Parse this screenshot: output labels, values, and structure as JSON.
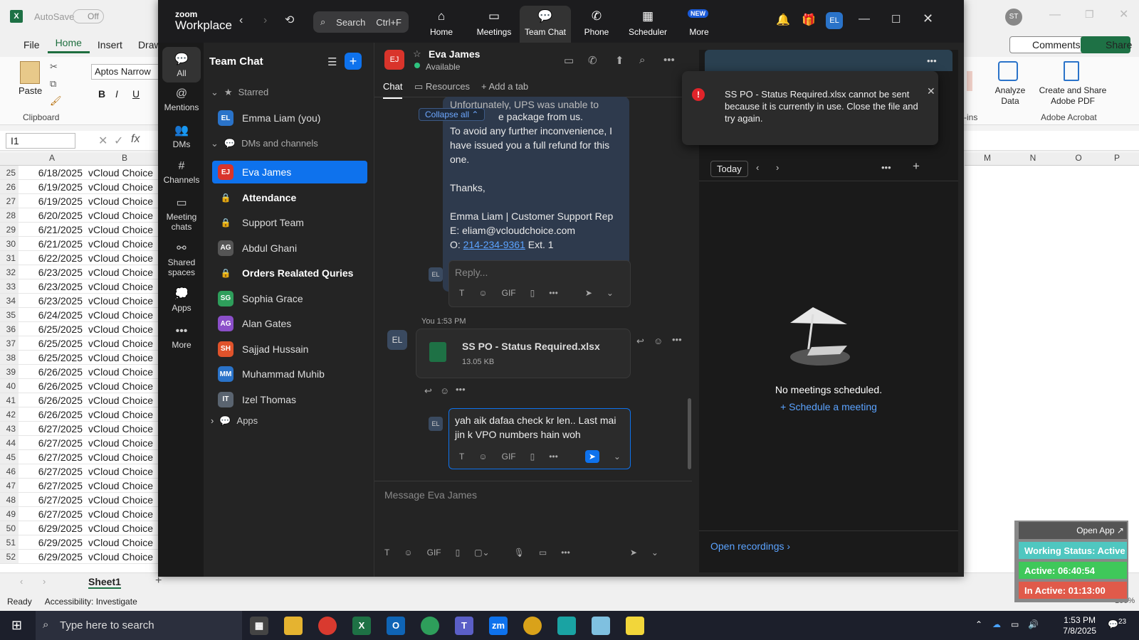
{
  "excel": {
    "autosave_label": "AutoSave",
    "autosave_state": "Off",
    "menu": [
      "File",
      "Home",
      "Insert",
      "Draw"
    ],
    "font_name": "Aptos Narrow",
    "paste_label": "Paste",
    "clipboard_label": "Clipboard",
    "name_box": "I1",
    "col_a": "A",
    "col_b": "B",
    "right_cols": [
      "M",
      "N",
      "O",
      "P"
    ],
    "user_initials": "ST",
    "comments_label": "Comments",
    "share_label": "Share",
    "analyze_label": "Analyze Data",
    "adobe_label": "Create and Share Adobe PDF",
    "adobe_group": "Adobe Acrobat",
    "addins_label": "-ins",
    "rows": [
      {
        "n": "25",
        "a": "6/18/2025",
        "b": "vCloud Choice"
      },
      {
        "n": "26",
        "a": "6/19/2025",
        "b": "vCloud Choice"
      },
      {
        "n": "27",
        "a": "6/19/2025",
        "b": "vCloud Choice"
      },
      {
        "n": "28",
        "a": "6/20/2025",
        "b": "vCloud Choice"
      },
      {
        "n": "29",
        "a": "6/21/2025",
        "b": "vCloud Choice"
      },
      {
        "n": "30",
        "a": "6/21/2025",
        "b": "vCloud Choice"
      },
      {
        "n": "31",
        "a": "6/22/2025",
        "b": "vCloud Choice"
      },
      {
        "n": "32",
        "a": "6/23/2025",
        "b": "vCloud Choice"
      },
      {
        "n": "33",
        "a": "6/23/2025",
        "b": "vCloud Choice"
      },
      {
        "n": "34",
        "a": "6/23/2025",
        "b": "vCloud Choice"
      },
      {
        "n": "35",
        "a": "6/24/2025",
        "b": "vCloud Choice"
      },
      {
        "n": "36",
        "a": "6/25/2025",
        "b": "vCloud Choice"
      },
      {
        "n": "37",
        "a": "6/25/2025",
        "b": "vCloud Choice"
      },
      {
        "n": "38",
        "a": "6/25/2025",
        "b": "vCloud Choice"
      },
      {
        "n": "39",
        "a": "6/26/2025",
        "b": "vCloud Choice"
      },
      {
        "n": "40",
        "a": "6/26/2025",
        "b": "vCloud Choice"
      },
      {
        "n": "41",
        "a": "6/26/2025",
        "b": "vCloud Choice"
      },
      {
        "n": "42",
        "a": "6/26/2025",
        "b": "vCloud Choice"
      },
      {
        "n": "43",
        "a": "6/27/2025",
        "b": "vCloud Choice"
      },
      {
        "n": "44",
        "a": "6/27/2025",
        "b": "vCloud Choice"
      },
      {
        "n": "45",
        "a": "6/27/2025",
        "b": "vCloud Choice"
      },
      {
        "n": "46",
        "a": "6/27/2025",
        "b": "vCloud Choice"
      },
      {
        "n": "47",
        "a": "6/27/2025",
        "b": "vCloud Choice"
      },
      {
        "n": "48",
        "a": "6/27/2025",
        "b": "vCloud Choice"
      },
      {
        "n": "49",
        "a": "6/27/2025",
        "b": "vCloud Choice"
      },
      {
        "n": "50",
        "a": "6/29/2025",
        "b": "vCloud Choice"
      },
      {
        "n": "51",
        "a": "6/29/2025",
        "b": "vCloud Choice"
      },
      {
        "n": "52",
        "a": "6/29/2025",
        "b": "vCloud Choice"
      }
    ],
    "sheet_tab": "Sheet1",
    "status_ready": "Ready",
    "status_access": "Accessibility: Investigate",
    "zoom_pct": "100%"
  },
  "zoom": {
    "brand_top": "zoom",
    "brand_bottom": "Workplace",
    "search_label": "Search",
    "search_shortcut": "Ctrl+F",
    "tabs": [
      "Home",
      "Meetings",
      "Team Chat",
      "Phone",
      "Scheduler",
      "More"
    ],
    "new_badge": "NEW",
    "user_initials": "EL",
    "left_nav": [
      "All",
      "Mentions",
      "DMs",
      "Channels",
      "Meeting chats",
      "Shared spaces",
      "Apps",
      "More"
    ],
    "list_title": "Team Chat",
    "starred_label": "Starred",
    "starred_item": "Emma Liam (you)",
    "dms_label": "DMs and channels",
    "contacts": [
      {
        "name": "Eva James",
        "initials": "EJ",
        "color": "#d9342b",
        "type": "avatar"
      },
      {
        "name": "Attendance",
        "type": "lock",
        "bold": true
      },
      {
        "name": "Support Team",
        "type": "lock"
      },
      {
        "name": "Abdul Ghani",
        "initials": "AG",
        "color": "#555",
        "type": "avatar"
      },
      {
        "name": "Orders Realated Quries",
        "type": "lock",
        "bold": true
      },
      {
        "name": "Sophia Grace",
        "initials": "SG",
        "color": "#2e9e5b",
        "type": "avatar"
      },
      {
        "name": "Alan Gates",
        "initials": "AG",
        "color": "#8b4fc9",
        "type": "avatar"
      },
      {
        "name": "Sajjad Hussain",
        "initials": "SH",
        "color": "#e0532b",
        "type": "avatar"
      },
      {
        "name": "Muhammad Muhib",
        "initials": "MM",
        "color": "#2a73c9",
        "type": "avatar"
      },
      {
        "name": "Izel Thomas",
        "initials": "IT",
        "color": "#5a6470",
        "type": "avatar"
      }
    ],
    "apps_label": "Apps",
    "chat_name": "Eva James",
    "chat_initials": "EJ",
    "chat_status": "Available",
    "chat_tabs": [
      "Chat",
      "Resources",
      "Add a tab"
    ],
    "collapse_all": "Collapse all",
    "msg_line0": "Unfortunately, UPS was unable to",
    "msg_line1": "e package from us.",
    "msg_line2": "To avoid any further inconvenience, I",
    "msg_line3": "have issued you a full refund for this",
    "msg_line4": "one.",
    "msg_thanks": "Thanks,",
    "msg_sig1": "Emma Liam | Customer Support Rep",
    "msg_sig2": " E: eliam@vcloudchoice.com",
    "msg_phone_prefix": "O: ",
    "msg_phone": "214-234-9361",
    "msg_ext": " Ext. 1",
    "reply_placeholder": "Reply...",
    "you_time": "You 1:53 PM",
    "file_name": "SS PO - Status Required.xlsx",
    "file_size": "13.05 KB",
    "draft_text": "yah aik dafaa check kr len.. Last mai jin k VPO numbers hain woh",
    "message_placeholder": "Message Eva James",
    "gif": "GIF",
    "notification": "SS PO - Status Required.xlsx cannot be sent because it is currently in use. Close the file and try again.",
    "today_label": "Today",
    "no_meetings": "No meetings scheduled.",
    "schedule_meeting": "Schedule a meeting",
    "open_recordings": "Open recordings"
  },
  "widget": {
    "open_app": "Open App ↗",
    "working_status": "Working Status: Active",
    "active": "Active: 06:40:54",
    "inactive": "In Active: 01:13:00"
  },
  "taskbar": {
    "search_placeholder": "Type here to search",
    "time": "1:53 PM",
    "date": "7/8/2025",
    "notif_count": "23"
  }
}
